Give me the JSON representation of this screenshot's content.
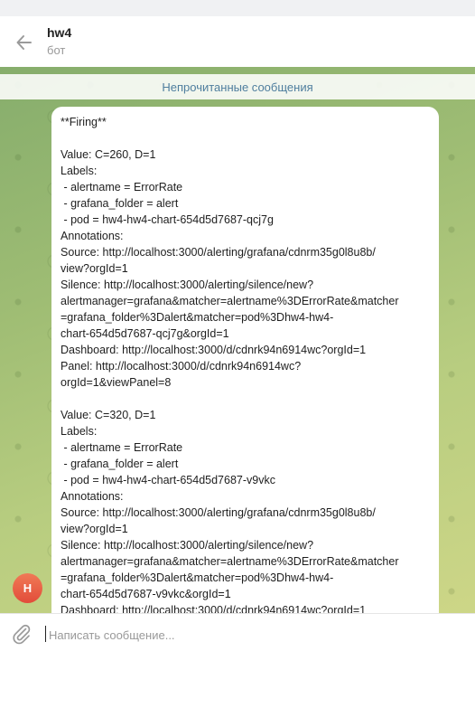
{
  "header": {
    "title": "hw4",
    "subtitle": "бот"
  },
  "chat": {
    "unread_divider": "Непрочитанные сообщения",
    "avatar_letter": "H",
    "message_lines": [
      "**Firing**",
      "",
      "Value: C=260, D=1",
      "Labels:",
      " - alertname = ErrorRate",
      " - grafana_folder = alert",
      " - pod = hw4-hw4-chart-654d5d7687-qcj7g",
      "Annotations:",
      "Source: http://localhost:3000/alerting/grafana/cdnrm35g0l8u8b/",
      "view?orgId=1",
      "Silence: http://localhost:3000/alerting/silence/new?",
      "alertmanager=grafana&matcher=alertname%3DErrorRate&matcher",
      "=grafana_folder%3Dalert&matcher=pod%3Dhw4-hw4-",
      "chart-654d5d7687-qcj7g&orgId=1",
      "Dashboard: http://localhost:3000/d/cdnrk94n6914wc?orgId=1",
      "Panel: http://localhost:3000/d/cdnrk94n6914wc?",
      "orgId=1&viewPanel=8",
      "",
      "Value: C=320, D=1",
      "Labels:",
      " - alertname = ErrorRate",
      " - grafana_folder = alert",
      " - pod = hw4-hw4-chart-654d5d7687-v9vkc",
      "Annotations:",
      "Source: http://localhost:3000/alerting/grafana/cdnrm35g0l8u8b/",
      "view?orgId=1",
      "Silence: http://localhost:3000/alerting/silence/new?",
      "alertmanager=grafana&matcher=alertname%3DErrorRate&matcher",
      "=grafana_folder%3Dalert&matcher=pod%3Dhw4-hw4-",
      "chart-654d5d7687-v9vkc&orgId=1",
      "Dashboard: http://localhost:3000/d/cdnrk94n6914wc?orgId=1"
    ]
  },
  "composer": {
    "placeholder": "Написать сообщение...",
    "value": ""
  },
  "icons": {
    "back": "arrow-left-icon",
    "attach": "paperclip-icon"
  }
}
